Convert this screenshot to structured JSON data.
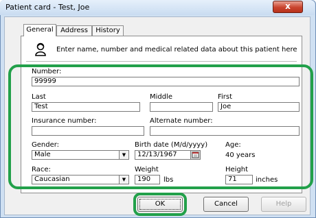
{
  "window": {
    "title": "Patient card - Test, Joe",
    "close_glyph": "x"
  },
  "tabs": [
    {
      "label": "General",
      "active": true
    },
    {
      "label": "Address",
      "active": false
    },
    {
      "label": "History",
      "active": false
    }
  ],
  "info": {
    "icon": "person-info-icon",
    "text": "Enter name, number and medical related data about this patient here"
  },
  "fields": {
    "number": {
      "label": "Number:",
      "value": "99999"
    },
    "last": {
      "label": "Last",
      "value": "Test"
    },
    "middle": {
      "label": "Middle",
      "value": ""
    },
    "first": {
      "label": "First",
      "value": "Joe"
    },
    "insurance": {
      "label": "Insurance number:",
      "value": ""
    },
    "alternate": {
      "label": "Alternate number:",
      "value": ""
    },
    "gender": {
      "label": "Gender:",
      "value": "Male"
    },
    "birth_date": {
      "label": "Birth date  (M/d/yyyy)",
      "value": "12/13/1967",
      "icon": "calendar-icon"
    },
    "age": {
      "label": "Age:",
      "value": "40 years"
    },
    "race": {
      "label": "Race:",
      "value": "Caucasian"
    },
    "weight": {
      "label": "Weight",
      "value": "190",
      "unit": "lbs"
    },
    "height": {
      "label": "Height",
      "value": "71",
      "unit": "inches"
    }
  },
  "buttons": {
    "ok": "OK",
    "cancel": "Cancel",
    "help": "Help"
  },
  "colors": {
    "highlight": "#22a04a",
    "close_button": "#c9442e"
  }
}
